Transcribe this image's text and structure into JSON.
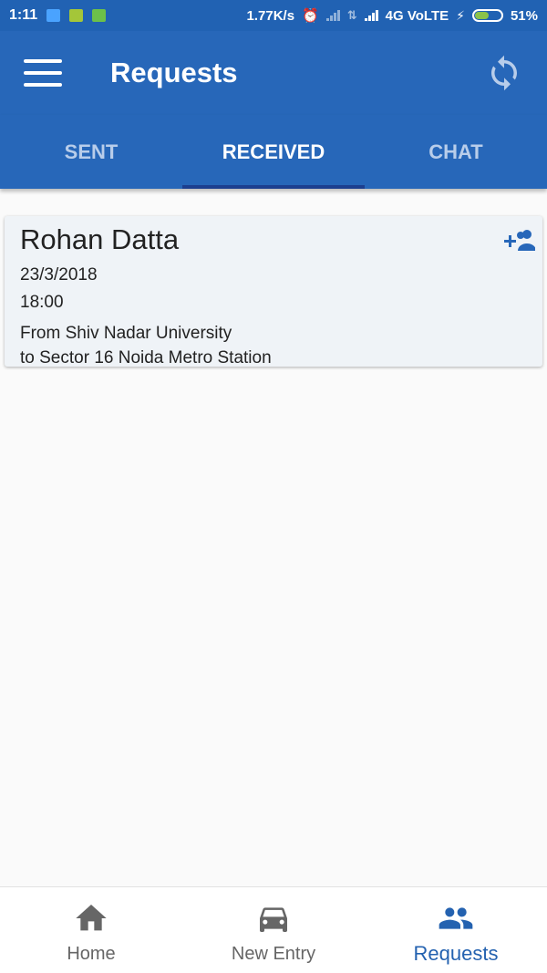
{
  "status_bar": {
    "time": "1:11",
    "speed": "1.77K/s",
    "network": "4G VoLTE",
    "battery": "51%",
    "battery_level": 0.51
  },
  "app_bar": {
    "title": "Requests",
    "menu_icon": "hamburger-menu-icon",
    "refresh_icon": "refresh-icon"
  },
  "tabs": [
    {
      "label": "SENT",
      "active": false
    },
    {
      "label": "RECEIVED",
      "active": true
    },
    {
      "label": "CHAT",
      "active": false
    }
  ],
  "requests": [
    {
      "name": "Rohan Datta",
      "date": "23/3/2018",
      "time": "18:00",
      "from": "From Shiv Nadar University",
      "to": "to Sector 16 Noida Metro Station",
      "action_icon": "add-friend-icon"
    }
  ],
  "bottom_nav": [
    {
      "label": "Home",
      "icon": "home-icon",
      "active": false
    },
    {
      "label": "New Entry",
      "icon": "car-icon",
      "active": false
    },
    {
      "label": "Requests",
      "icon": "people-icon",
      "active": true
    }
  ],
  "colors": {
    "primary": "#2767b9",
    "accent_dark": "#1c3f8f",
    "card_bg": "#eff3f7",
    "active_nav": "#2462b0"
  }
}
